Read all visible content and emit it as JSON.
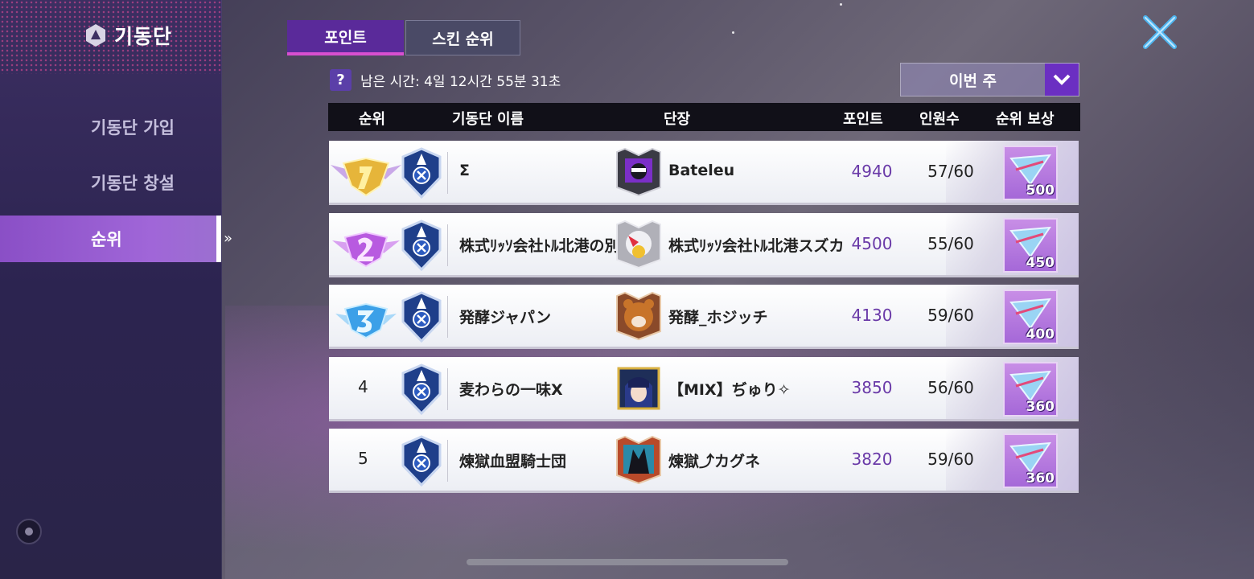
{
  "sidebar": {
    "title": "기동단",
    "items": [
      {
        "label": "기동단 가입",
        "active": false
      },
      {
        "label": "기동단 창설",
        "active": false
      },
      {
        "label": "순위",
        "active": true
      }
    ]
  },
  "tabs": [
    {
      "label": "포인트",
      "active": true
    },
    {
      "label": "스킨 순위",
      "active": false
    }
  ],
  "timer": {
    "text": "남은 시간: 4일 12시간 55분 31초",
    "help_icon": "?"
  },
  "period_select": {
    "selected": "이번 주"
  },
  "table": {
    "headers": {
      "rank": "순위",
      "guild_name": "기동단 이름",
      "leader": "단장",
      "points": "포인트",
      "members": "인원수",
      "reward": "순위 보상"
    },
    "rows": [
      {
        "rank": "1",
        "guild_name": "Σ",
        "leader": "Bateleu",
        "points": "4940",
        "members": "57/60",
        "reward": "500"
      },
      {
        "rank": "2",
        "guild_name": "株式ﾘｯｿ会社ﾄﾙ北港の別荘",
        "leader": "株式ﾘｯｿ会社ﾄﾙ北港スズカ",
        "points": "4500",
        "members": "55/60",
        "reward": "450"
      },
      {
        "rank": "3",
        "guild_name": "発酵ジャパン",
        "leader": "発酵_ホジッチ",
        "points": "4130",
        "members": "59/60",
        "reward": "400"
      },
      {
        "rank": "4",
        "guild_name": "麦わらの一味X",
        "leader": "【MIX】ぢゅり✧",
        "points": "3850",
        "members": "56/60",
        "reward": "360"
      },
      {
        "rank": "5",
        "guild_name": "煉獄血盟騎士団",
        "leader": "煉獄⤴カグネ",
        "points": "3820",
        "members": "59/60",
        "reward": "360"
      }
    ]
  },
  "colors": {
    "accent_purple": "#6b2fc2",
    "points_purple": "#6a3aa8",
    "medal_gold": "#e6b53a",
    "medal_purple": "#b85ae0",
    "medal_blue": "#3ca0e8"
  }
}
